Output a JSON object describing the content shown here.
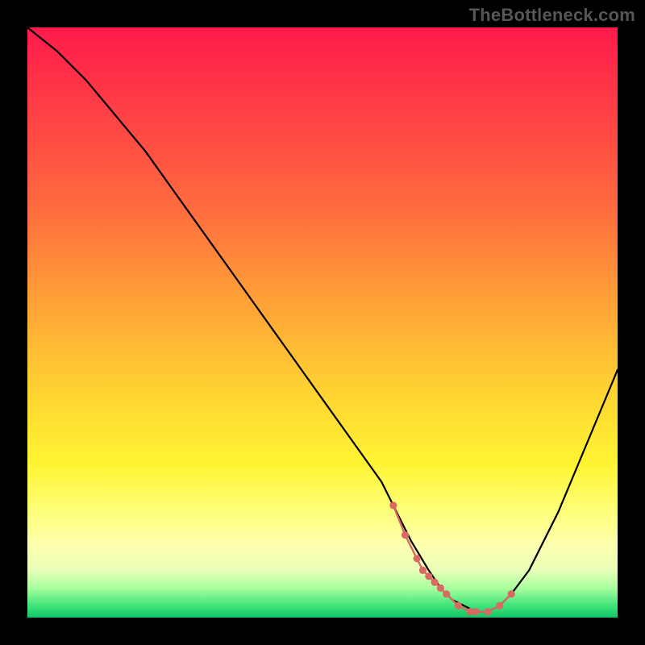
{
  "watermark": "TheBottleneck.com",
  "colors": {
    "frame": "#000000",
    "curve": "#000000",
    "marker": "#d86a63",
    "gradient_top": "#ff1a4b",
    "gradient_bottom": "#11c566"
  },
  "chart_data": {
    "type": "line",
    "title": "",
    "xlabel": "",
    "ylabel": "",
    "xlim": [
      0,
      100
    ],
    "ylim": [
      0,
      100
    ],
    "series": [
      {
        "name": "bottleneck-curve",
        "x": [
          0,
          5,
          10,
          15,
          20,
          25,
          30,
          35,
          40,
          45,
          50,
          55,
          60,
          62,
          65,
          68,
          70,
          72,
          74,
          76,
          78,
          80,
          82,
          85,
          90,
          95,
          100
        ],
        "y": [
          100,
          96,
          91,
          85,
          79,
          72,
          65,
          58,
          51,
          44,
          37,
          30,
          23,
          19,
          13,
          8,
          5,
          3,
          2,
          1,
          1,
          2,
          4,
          8,
          18,
          30,
          42
        ]
      }
    ],
    "highlight_points": {
      "name": "optimal-zone-markers",
      "x": [
        62,
        64,
        66,
        67,
        68,
        69,
        70,
        71,
        73,
        75,
        76,
        78,
        80,
        82
      ],
      "y": [
        19,
        14,
        10,
        8,
        7,
        6,
        5,
        4,
        2,
        1,
        1,
        1,
        2,
        4
      ]
    }
  }
}
